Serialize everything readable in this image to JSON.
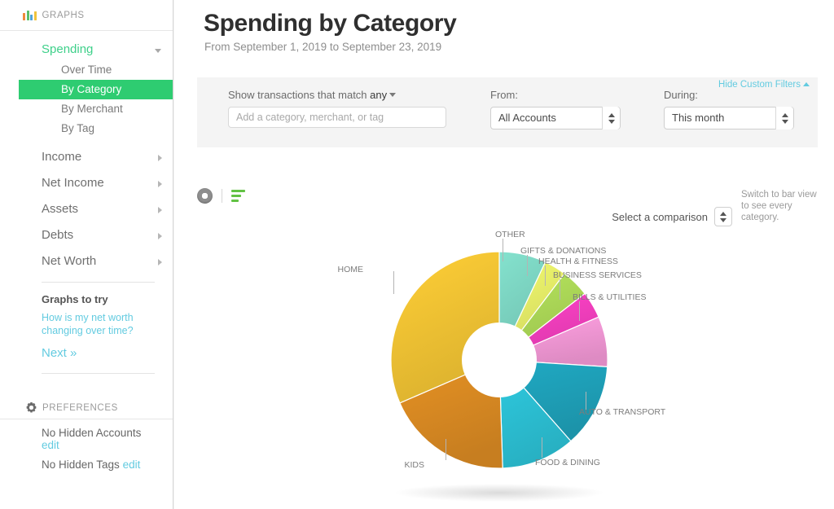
{
  "sidebar": {
    "header": {
      "label": "GRAPHS",
      "icon": "bar-chart-icon"
    },
    "group": {
      "label": "Spending",
      "caret": "chevron-down-icon"
    },
    "sub_items": [
      {
        "label": "Over Time",
        "active": false
      },
      {
        "label": "By Category",
        "active": true
      },
      {
        "label": "By Merchant",
        "active": false
      },
      {
        "label": "By Tag",
        "active": false
      }
    ],
    "items": [
      {
        "label": "Income"
      },
      {
        "label": "Net Income"
      },
      {
        "label": "Assets"
      },
      {
        "label": "Debts"
      },
      {
        "label": "Net Worth"
      }
    ],
    "graphs_to_try": {
      "title": "Graphs to try",
      "link": "How is my net worth changing over time?",
      "next": "Next »"
    },
    "preferences": {
      "header": "PREFERENCES",
      "rows": [
        {
          "text": "No Hidden Accounts",
          "edit": "edit"
        },
        {
          "text": "No Hidden Tags",
          "edit": "edit"
        }
      ]
    }
  },
  "header": {
    "title": "Spending by Category",
    "subtitle": "From September 1, 2019 to September 23, 2019"
  },
  "filters": {
    "hide_link": "Hide Custom Filters",
    "match_label_prefix": "Show transactions that match",
    "match_value": "any",
    "tag_placeholder": "Add a category, merchant, or tag",
    "tag_value": "",
    "from_label": "From:",
    "from_value": "All Accounts",
    "during_label": "During:",
    "during_value": "This month"
  },
  "chart_toolbar": {
    "donut_view": "donut-view-icon",
    "bar_view": "bar-view-icon",
    "comparison_label": "Select a comparison",
    "hint": "Switch to bar view to see every category."
  },
  "chart_data": {
    "type": "pie",
    "title": "Spending by Category",
    "subtitle": "From September 1, 2019 to September 23, 2019",
    "donut": true,
    "inner_radius_ratio": 0.3,
    "start_angle_deg": -90,
    "direction": "clockwise",
    "legend": "none",
    "grid": false,
    "labels": [
      "OTHER",
      "GIFTS & DONATIONS",
      "HEALTH & FITNESS",
      "BUSINESS SERVICES",
      "BILLS & UTILITIES",
      "AUTO & TRANSPORT",
      "FOOD & DINING",
      "KIDS",
      "HOME"
    ],
    "values": [
      7.0,
      3.3,
      4.2,
      4.0,
      7.5,
      12.5,
      11.0,
      19.0,
      31.5
    ],
    "colors": [
      "#7fd9c6",
      "#e9f06a",
      "#aedb58",
      "#f53fc0",
      "#f79ad9",
      "#1fa3bc",
      "#2cc3d8",
      "#dd8c23",
      "#f5c734"
    ],
    "units": "percent of total spending"
  }
}
